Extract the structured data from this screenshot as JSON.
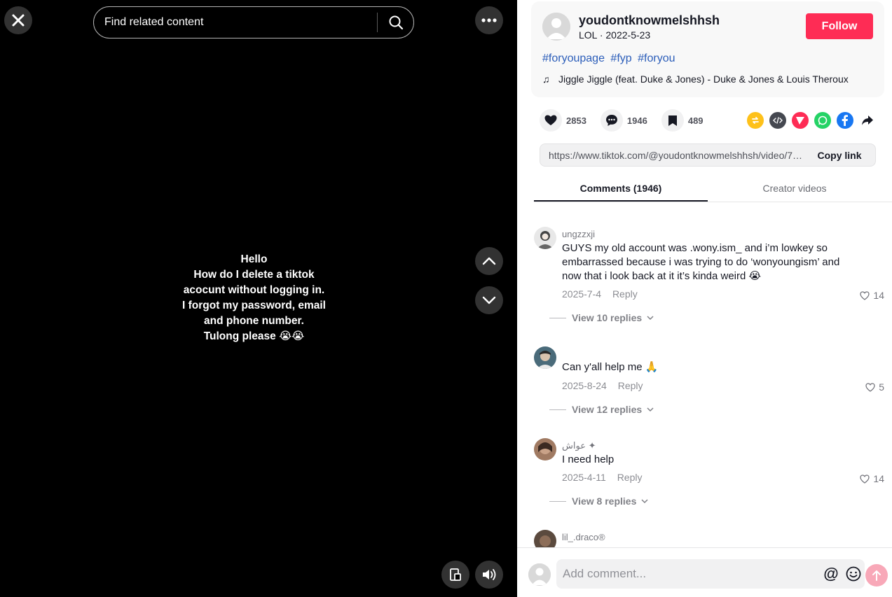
{
  "video": {
    "search_placeholder": "Find related content",
    "caption_lines": [
      "Hello",
      "How do I delete a tiktok",
      "acocunt without logging in.",
      "I forgot my password, email",
      "and phone number.",
      "Tulong please 😭😭"
    ]
  },
  "post": {
    "author": "youdontknowmelshhsh",
    "nickname_date": "LOL · 2022-5-23",
    "follow_label": "Follow",
    "hashtags": [
      "#foryoupage",
      "#fyp",
      "#foryou"
    ],
    "music_icon": "♫",
    "music": "Jiggle Jiggle (feat. Duke & Jones) - Duke & Jones & Louis Theroux",
    "likes": "2853",
    "comments": "1946",
    "saves": "489",
    "link": "https://www.tiktok.com/@youdontknowmelshhsh/video/710...",
    "copy_link_label": "Copy link"
  },
  "tabs": [
    {
      "label": "Comments (1946)"
    },
    {
      "label": "Creator videos"
    }
  ],
  "comments": [
    {
      "user": "ungzzxji",
      "text": "GUYS my old account was .wony.ism_ and i’m lowkey so embarrassed because i was trying to do ‘wonyoungism’ and now that i look back at it it’s kinda weird 😭",
      "date": "2025-7-4",
      "reply_label": "Reply",
      "likes": "14",
      "replies": "View 10 replies"
    },
    {
      "user": "",
      "text": "Can y'all help me 🙏",
      "date": "2025-8-24",
      "reply_label": "Reply",
      "likes": "5",
      "replies": "View 12 replies"
    },
    {
      "user": "عواش ✦",
      "text": "I need help",
      "date": "2025-4-11",
      "reply_label": "Reply",
      "likes": "14",
      "replies": "View 8 replies"
    },
    {
      "user": "lil_.draco®",
      "text": "",
      "date": "",
      "reply_label": "",
      "likes": "",
      "replies": ""
    }
  ],
  "comment_bar": {
    "placeholder": "Add comment...",
    "mention_glyph": "@"
  },
  "colors": {
    "accent": "#fe2c55",
    "hashtag": "#2b5db9",
    "video_bg": "#000000"
  },
  "icons": {
    "close": "close-icon",
    "search": "search-icon",
    "more": "more-icon",
    "up": "chevron-up-icon",
    "down": "chevron-down-icon",
    "pip": "floating-player-icon",
    "volume": "volume-icon"
  }
}
